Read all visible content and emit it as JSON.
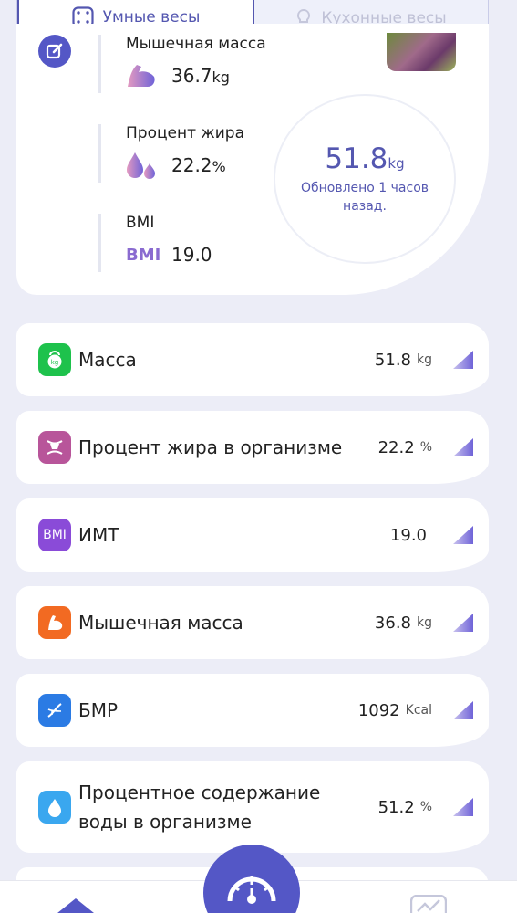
{
  "tabs": [
    {
      "label": "Умные весы",
      "active": true
    },
    {
      "label": "Кухонные весы",
      "active": false
    }
  ],
  "summary": {
    "muscle": {
      "label": "Мышечная масса",
      "value": "36.7",
      "unit": "kg"
    },
    "fat": {
      "label": "Процент жира",
      "value": "22.2",
      "unit": "%"
    },
    "bmi": {
      "label": "BMI",
      "value": "19.0",
      "icon_text": "BMI"
    },
    "weight": {
      "value": "51.8",
      "unit": "kg",
      "updated": "Обновлено 1 часов назад."
    }
  },
  "items": [
    {
      "name": "Масса",
      "value": "51.8",
      "unit": "kg",
      "icon": "kettlebell-icon",
      "color": "#1ec24c"
    },
    {
      "name": "Процент жира в организме",
      "value": "22.2",
      "unit": "%",
      "icon": "body-fat-icon",
      "color": "#b8559a"
    },
    {
      "name": "ИМТ",
      "value": "19.0",
      "unit": "",
      "icon": "bmi-icon",
      "icon_text": "BMI",
      "color": "#8a4bd8"
    },
    {
      "name": "Мышечная масса",
      "value": "36.8",
      "unit": "kg",
      "icon": "muscle-icon",
      "color": "#f26a22"
    },
    {
      "name": "БМР",
      "value": "1092",
      "unit": "Kcal",
      "icon": "dna-icon",
      "color": "#2b7be4"
    },
    {
      "name": "Процентное содержание воды в организме",
      "value": "51.2",
      "unit": "%",
      "icon": "water-drop-icon",
      "color": "#3aa7ef"
    }
  ],
  "colors": {
    "accent": "#5457c6",
    "background": "#ecedf7"
  }
}
